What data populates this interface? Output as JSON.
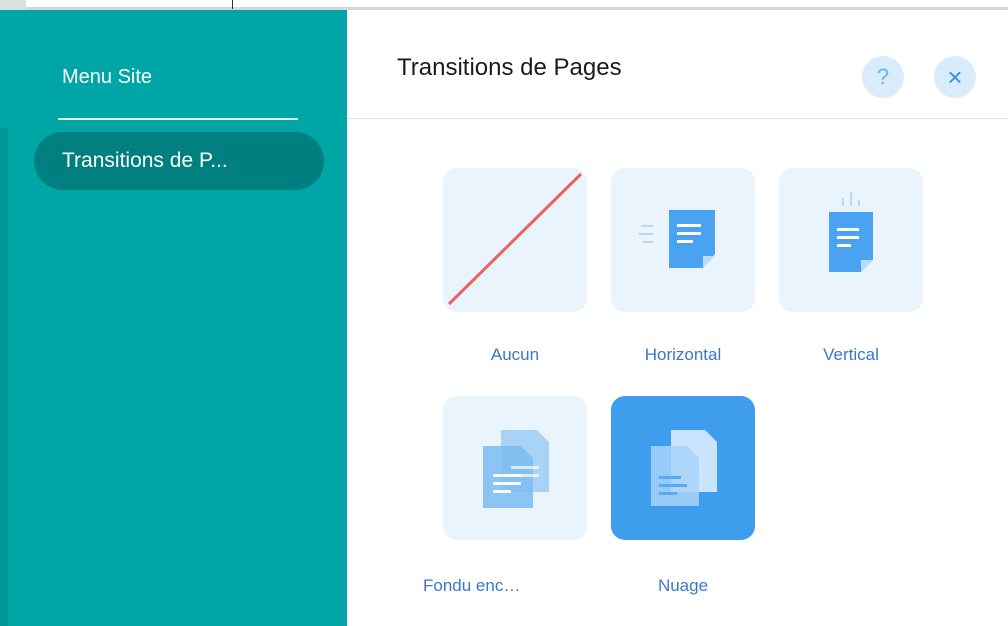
{
  "sidebar": {
    "title": "Menu Site",
    "items": [
      {
        "label": "Transitions de P..."
      }
    ]
  },
  "panel": {
    "title": "Transitions de Pages",
    "help_label": "?",
    "close_label": "×"
  },
  "transitions": [
    {
      "label": "Aucun",
      "icon": "none-slash-icon",
      "selected": false
    },
    {
      "label": "Horizontal",
      "icon": "horizontal-page-icon",
      "selected": false
    },
    {
      "label": "Vertical",
      "icon": "vertical-page-icon",
      "selected": false
    },
    {
      "label": "Fondu enc…",
      "icon": "crossfade-pages-icon",
      "selected": false
    },
    {
      "label": "Nuage",
      "icon": "cloud-pages-icon",
      "selected": true
    }
  ],
  "colors": {
    "sidebar_bg": "#00a5a6",
    "sidebar_active": "#007f81",
    "tile_bg": "#e9f4fd",
    "tile_selected": "#3e9ded",
    "accent": "#3b78c8",
    "slash": "#e9635f"
  }
}
